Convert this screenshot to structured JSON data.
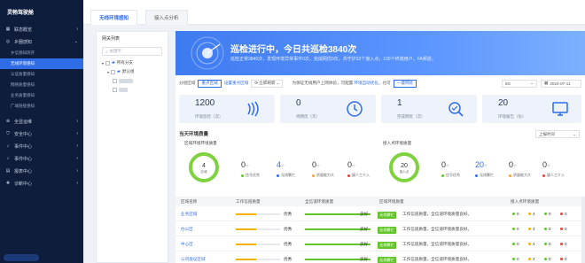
{
  "app": {
    "title": "灵畅驾驶舱"
  },
  "sidebar": {
    "items": [
      {
        "label": "联态概览",
        "icon": "dashboard-icon",
        "expanded": false
      },
      {
        "label": "乡圈感知",
        "icon": "target-icon",
        "expanded": true
      }
    ],
    "sub_items": [
      {
        "label": "乡信感知风存",
        "active": false
      },
      {
        "label": "无线环境感知",
        "active": true
      },
      {
        "label": "认证质量感知",
        "active": false
      },
      {
        "label": "网络质量感知",
        "active": false
      },
      {
        "label": "业务质量感知",
        "active": false
      },
      {
        "label": "广域链接感知",
        "active": false
      }
    ],
    "bottom_items": [
      {
        "label": "全显运维",
        "icon": "globe-icon"
      },
      {
        "label": "安全中心",
        "icon": "shield-icon"
      },
      {
        "label": "事件中心",
        "icon": "bell-icon"
      },
      {
        "label": "事件中心",
        "icon": "bell-icon"
      },
      {
        "label": "报表中心",
        "icon": "report-icon"
      },
      {
        "label": "诊断中心",
        "icon": "stethoscope-icon"
      }
    ]
  },
  "tabs": [
    {
      "label": "无线环境感知",
      "active": true
    },
    {
      "label": "接入点分析",
      "active": false
    }
  ],
  "tree": {
    "title": "网关列表",
    "search_placeholder": "关键字",
    "root_label": "所有分支",
    "child_label": "默认组"
  },
  "hero": {
    "title": "巡检进行中，今日共巡检3840次",
    "description": "巡检正常3840次，发现环境异常事件0次，完成网优0次，共守护32个接入点，100个终端用户，FA频道。"
  },
  "filters": {
    "label": "分组区域",
    "btn_group": "重点区域",
    "link_set": "设置重点区域",
    "btn_filter": "立即刷新",
    "hint": "为保证无线用户上网体验，可配置",
    "hint_link": "环境自动优化",
    "hint_suffix": "，也可",
    "btn_optimize": "一键网优",
    "band_select": "5G",
    "date_select": "2024-07-11"
  },
  "stats": [
    {
      "value": "1200",
      "label": "环境巡检（次）",
      "icon": "signal-icon"
    },
    {
      "value": "0",
      "label": "待网优（次）",
      "icon": "clock-icon"
    },
    {
      "value": "1",
      "label": "完成网优（次）",
      "icon": "search-check-icon"
    },
    {
      "value": "20",
      "label": "环境报告（份）",
      "icon": "monitor-icon"
    }
  ],
  "quality": {
    "title": "当天环境质量",
    "select": "上报时间",
    "left": {
      "label": "区域环境环境质量",
      "ring_value": "4",
      "ring_label": "区域",
      "metrics": [
        {
          "value": "0",
          "unit": "个",
          "label": "信号优秀",
          "color": "#62c42b"
        },
        {
          "value": "4",
          "unit": "个",
          "label": "无线繁忙",
          "color": "#2f6de6"
        },
        {
          "value": "0",
          "unit": "个",
          "label": "质量能力大",
          "color": "#f2a33a"
        },
        {
          "value": "0",
          "unit": "个",
          "label": "疑人工介入",
          "color": "#e0453a"
        }
      ]
    },
    "right": {
      "label": "接入点环境质量",
      "ring_value": "20",
      "ring_label": "接入点",
      "metrics": [
        {
          "value": "0",
          "unit": "个",
          "label": "信号优秀",
          "color": "#62c42b"
        },
        {
          "value": "20",
          "unit": "个",
          "label": "无线繁忙",
          "color": "#2f6de6"
        },
        {
          "value": "0",
          "unit": "个",
          "label": "质量能力大",
          "color": "#f2a33a"
        },
        {
          "value": "0",
          "unit": "个",
          "label": "疑人工介入",
          "color": "#e0453a"
        }
      ]
    }
  },
  "table": {
    "headers": [
      "区域名称",
      "工作信道质量",
      "全信道环境质量",
      "区域环境质量",
      "接入点环境质量"
    ],
    "rows": [
      {
        "name": "业务区域",
        "work_level": 0.45,
        "work_label": "优秀",
        "all_label": "良好",
        "tag": "无线繁忙",
        "desc": "工作信道质量，全信道环境质量良好。",
        "c1": "0",
        "c2": "4",
        "c3": "0",
        "c4": "0"
      },
      {
        "name": "办公区",
        "work_level": 0.45,
        "work_label": "优秀",
        "all_label": "良好",
        "tag": "无线繁忙",
        "desc": "工作信道质量，全信道环境质量良好。",
        "c1": "0",
        "c2": "4",
        "c3": "0",
        "c4": "0"
      },
      {
        "name": "中心区",
        "work_level": 0.45,
        "work_label": "优秀",
        "all_label": "良好",
        "tag": "无线繁忙",
        "desc": "工作信道质量，全信道环境质量良好。",
        "c1": "0",
        "c2": "4",
        "c3": "0",
        "c4": "0"
      },
      {
        "name": "公司会议区域",
        "work_level": 0.45,
        "work_label": "优秀",
        "all_label": "良好",
        "tag": "无线繁忙",
        "desc": "工作信道质量，全信道环境质量良好。",
        "c1": "0",
        "c2": "4",
        "c3": "0",
        "c4": "0"
      }
    ]
  },
  "colors": {
    "accent": "#2f6de6",
    "sidebar": "#0f1d3d",
    "good": "#62c42b",
    "warn": "#f2b200",
    "bad": "#e0453a"
  }
}
